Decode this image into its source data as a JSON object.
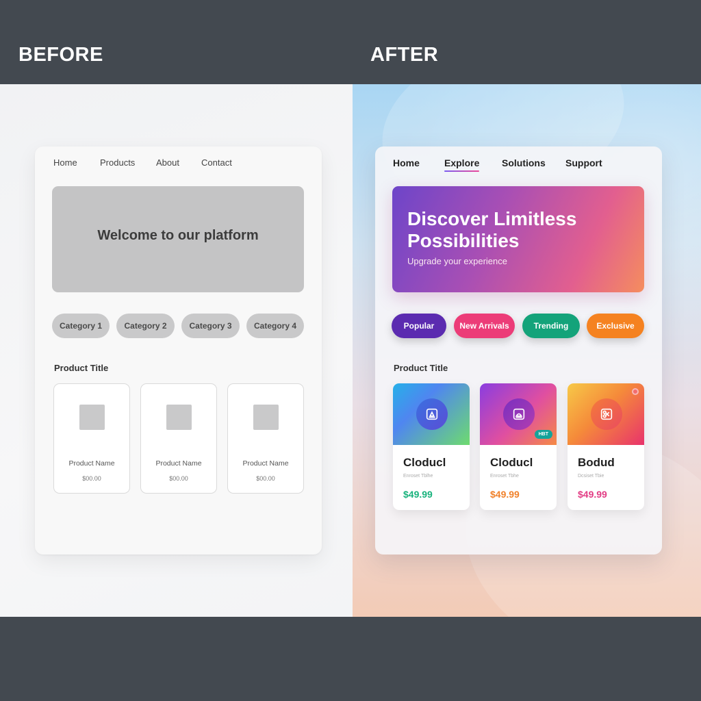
{
  "labels": {
    "before": "BEFORE",
    "after": "AFTER"
  },
  "before": {
    "nav": [
      "Home",
      "Products",
      "About",
      "Contact"
    ],
    "hero_text": "Welcome to our platform",
    "categories": [
      "Category 1",
      "Category 2",
      "Category 3",
      "Category 4"
    ],
    "section_title": "Product Title",
    "products": [
      {
        "name": "Product Name",
        "price": "$00.00"
      },
      {
        "name": "Product Name",
        "price": "$00.00"
      },
      {
        "name": "Product Name",
        "price": "$00.00"
      }
    ]
  },
  "after": {
    "nav": [
      "Home",
      "Explore",
      "Solutions",
      "Support"
    ],
    "active_nav": "Explore",
    "hero_title": "Discover Limitless Possibilities",
    "hero_subtitle": "Upgrade your experience",
    "categories": [
      {
        "label": "Popular",
        "color": "#5b2bb0"
      },
      {
        "label": "New Arrivals",
        "color": "#ec3c78"
      },
      {
        "label": "Trending",
        "color": "#14a37a"
      },
      {
        "label": "Exclusive",
        "color": "#f58220"
      }
    ],
    "section_title": "Product Title",
    "products": [
      {
        "title": "Cloducl",
        "subtitle": "Enroset Tblhe",
        "price": "$49.99",
        "price_color": "#18b27c",
        "icon": "image-icon"
      },
      {
        "title": "Cloducl",
        "subtitle": "Enroset Tbhe",
        "price": "$49.99",
        "price_color": "#f0812a",
        "icon": "image-icon",
        "badge": "HBT"
      },
      {
        "title": "Bodud",
        "subtitle": "Dcsiset Tbie",
        "price": "$49.99",
        "price_color": "#e23c84",
        "icon": "scissors-icon"
      }
    ]
  }
}
